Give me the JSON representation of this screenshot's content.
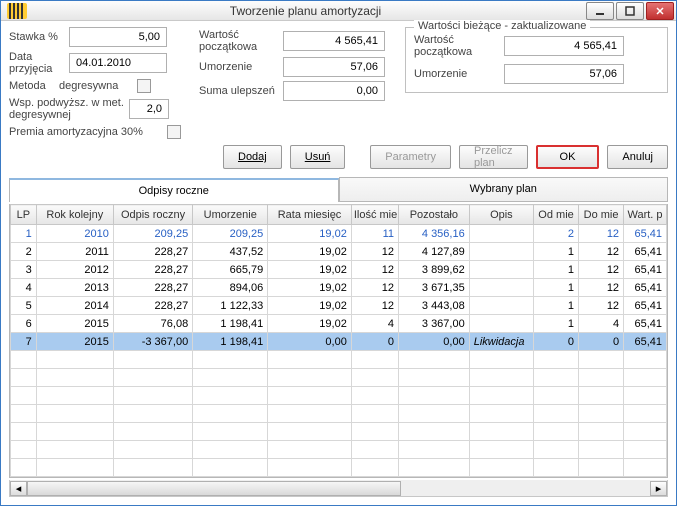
{
  "title": "Tworzenie planu amortyzacji",
  "left": {
    "rate_label": "Stawka %",
    "rate_value": "5,00",
    "date_label": "Data przyjęcia",
    "date_value": "04.01.2010",
    "method_label": "Metoda",
    "method_value": "degresywna",
    "coef_label": "Wsp. podwyższ. w met. degresywnej",
    "coef_value": "2,0",
    "bonus_label": "Premia amortyzacyjna 30%"
  },
  "mid": {
    "start_label": "Wartość początkowa",
    "start_value": "4 565,41",
    "amort_label": "Umorzenie",
    "amort_value": "57,06",
    "improv_label": "Suma ulepszeń",
    "improv_value": "0,00"
  },
  "current": {
    "legend": "Wartości bieżące - zaktualizowane",
    "start_label": "Wartość początkowa",
    "start_value": "4 565,41",
    "amort_label": "Umorzenie",
    "amort_value": "57,06"
  },
  "buttons": {
    "add": "Dodaj",
    "del": "Usuń",
    "params": "Parametry",
    "recalc": "Przelicz plan",
    "ok": "OK",
    "cancel": "Anuluj"
  },
  "tabs": {
    "annual": "Odpisy roczne",
    "selected": "Wybrany plan"
  },
  "columns": [
    "LP",
    "Rok kolejny",
    "Odpis roczny",
    "Umorzenie",
    "Rata miesięc",
    "Ilość mie",
    "Pozostało",
    "Opis",
    "Od mie",
    "Do mie",
    "Wart. p"
  ],
  "rows": [
    {
      "lp": "1",
      "rok": "2010",
      "odpis": "209,25",
      "umorz": "209,25",
      "rata": "19,02",
      "ilosc": "11",
      "pozost": "4 356,16",
      "opis": "",
      "od": "2",
      "do": "12",
      "wart": "65,41"
    },
    {
      "lp": "2",
      "rok": "2011",
      "odpis": "228,27",
      "umorz": "437,52",
      "rata": "19,02",
      "ilosc": "12",
      "pozost": "4 127,89",
      "opis": "",
      "od": "1",
      "do": "12",
      "wart": "65,41"
    },
    {
      "lp": "3",
      "rok": "2012",
      "odpis": "228,27",
      "umorz": "665,79",
      "rata": "19,02",
      "ilosc": "12",
      "pozost": "3 899,62",
      "opis": "",
      "od": "1",
      "do": "12",
      "wart": "65,41"
    },
    {
      "lp": "4",
      "rok": "2013",
      "odpis": "228,27",
      "umorz": "894,06",
      "rata": "19,02",
      "ilosc": "12",
      "pozost": "3 671,35",
      "opis": "",
      "od": "1",
      "do": "12",
      "wart": "65,41"
    },
    {
      "lp": "5",
      "rok": "2014",
      "odpis": "228,27",
      "umorz": "1 122,33",
      "rata": "19,02",
      "ilosc": "12",
      "pozost": "3 443,08",
      "opis": "",
      "od": "1",
      "do": "12",
      "wart": "65,41"
    },
    {
      "lp": "6",
      "rok": "2015",
      "odpis": "76,08",
      "umorz": "1 198,41",
      "rata": "19,02",
      "ilosc": "4",
      "pozost": "3 367,00",
      "opis": "",
      "od": "1",
      "do": "4",
      "wart": "65,41"
    },
    {
      "lp": "7",
      "rok": "2015",
      "odpis": "-3 367,00",
      "umorz": "1 198,41",
      "rata": "0,00",
      "ilosc": "0",
      "pozost": "0,00",
      "opis": "Likwidacja",
      "od": "0",
      "do": "0",
      "wart": "65,41"
    }
  ]
}
